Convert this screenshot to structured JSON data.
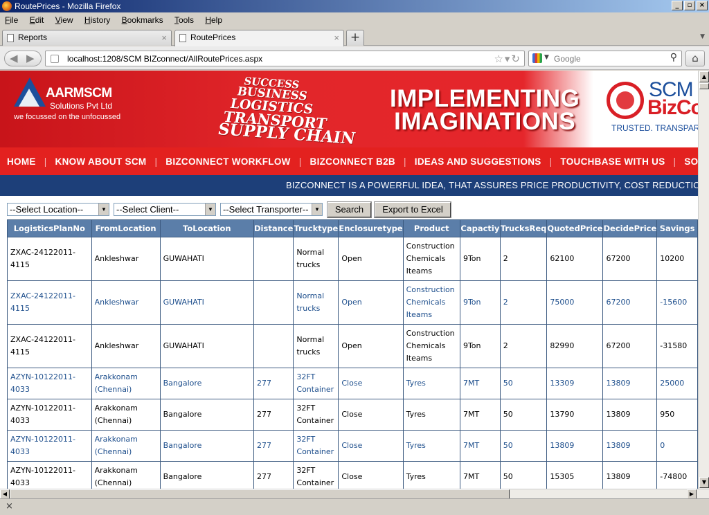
{
  "window": {
    "title": "RoutePrices - Mozilla Firefox"
  },
  "menu": [
    "File",
    "Edit",
    "View",
    "History",
    "Bookmarks",
    "Tools",
    "Help"
  ],
  "tabs": [
    {
      "label": "Reports"
    },
    {
      "label": "RoutePrices"
    }
  ],
  "address": {
    "url": "localhost:1208/SCM BIZconnect/AllRoutePrices.aspx"
  },
  "search": {
    "placeholder": "Google"
  },
  "header": {
    "company": "AARMSCM",
    "company_sub": "Solutions Pvt Ltd",
    "tagline": "we focussed on the unfocussed",
    "stair_words": [
      "SUCCESS",
      "BUSINESS",
      "LOGISTICS",
      "TRANSPORT",
      "SUPPLY CHAIN"
    ],
    "headline_1": "IMPLEMENTING",
    "headline_2": "IMAGINATIONS",
    "brand_1": "SCM",
    "brand_2": "BizCo",
    "brand_tag": "TRUSTED. TRANSPAREN"
  },
  "nav": [
    "HOME",
    "KNOW ABOUT SCM",
    "BIZCONNECT WORKFLOW",
    "BIZCONNECT B2B",
    "IDEAS AND SUGGESTIONS",
    "TOUCHBASE WITH US",
    "SOCIAL RESPONSI"
  ],
  "ticker": "BIZCONNECT IS A POWERFUL IDEA, THAT ASSURES PRICE PRODUCTIVITY, COST REDUCTION, SLA",
  "filters": {
    "location": "--Select Location--",
    "client": "--Select Client--",
    "transporter": "--Select Transporter--",
    "search_btn": "Search",
    "export_btn": "Export to Excel"
  },
  "table": {
    "columns": [
      "LogisticsPlanNo",
      "FromLocation",
      "ToLocation",
      "Distance",
      "Trucktype",
      "Enclosuretype",
      "Product",
      "Capactiy",
      "TrucksReq",
      "QuotedPrice",
      "DecidePrice",
      "Savings"
    ],
    "rows": [
      [
        "ZXAC-24122011-4115",
        "Ankleshwar",
        "GUWAHATI",
        "",
        "Normal trucks",
        "Open",
        "Construction Chemicals Iteams",
        "9Ton",
        "2",
        "62100",
        "67200",
        "10200"
      ],
      [
        "ZXAC-24122011-4115",
        "Ankleshwar",
        "GUWAHATI",
        "",
        "Normal trucks",
        "Open",
        "Construction Chemicals Iteams",
        "9Ton",
        "2",
        "75000",
        "67200",
        "-15600"
      ],
      [
        "ZXAC-24122011-4115",
        "Ankleshwar",
        "GUWAHATI",
        "",
        "Normal trucks",
        "Open",
        "Construction Chemicals Iteams",
        "9Ton",
        "2",
        "82990",
        "67200",
        "-31580"
      ],
      [
        "AZYN-10122011-4033",
        "Arakkonam (Chennai)",
        "Bangalore",
        "277",
        "32FT Container",
        "Close",
        "Tyres",
        "7MT",
        "50",
        "13309",
        "13809",
        "25000"
      ],
      [
        "AZYN-10122011-4033",
        "Arakkonam (Chennai)",
        "Bangalore",
        "277",
        "32FT Container",
        "Close",
        "Tyres",
        "7MT",
        "50",
        "13790",
        "13809",
        "950"
      ],
      [
        "AZYN-10122011-4033",
        "Arakkonam (Chennai)",
        "Bangalore",
        "277",
        "32FT Container",
        "Close",
        "Tyres",
        "7MT",
        "50",
        "13809",
        "13809",
        "0"
      ],
      [
        "AZYN-10122011-4033",
        "Arakkonam (Chennai)",
        "Bangalore",
        "277",
        "32FT Container",
        "Close",
        "Tyres",
        "7MT",
        "50",
        "15305",
        "13809",
        "-74800"
      ]
    ],
    "row_styles": [
      "black",
      "blue",
      "black",
      "blue",
      "black",
      "blue",
      "black"
    ]
  },
  "colors": {
    "header_red": "#e3211f",
    "ticker_blue": "#1d3f79",
    "grid_header": "#5b7ea9"
  }
}
